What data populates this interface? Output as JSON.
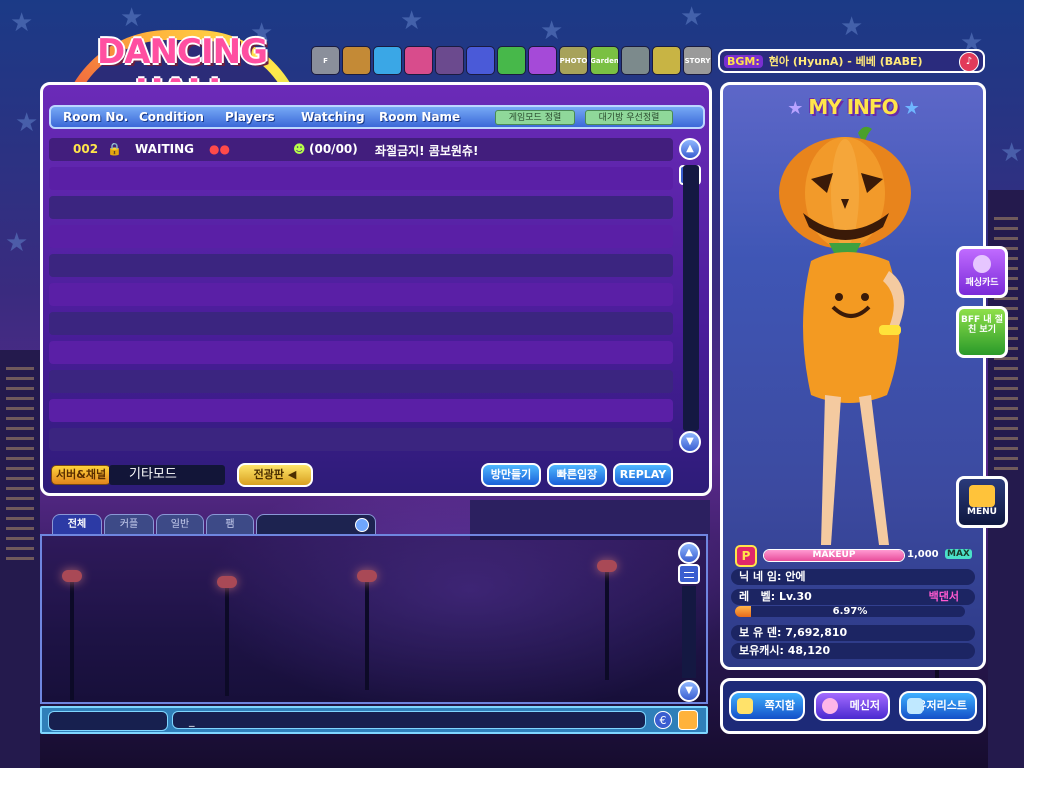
{
  "logo": {
    "text": "DANCING HALL"
  },
  "toolbar": [
    {
      "icon": "fashion-icon",
      "label": "F",
      "color": "#8a8f9b"
    },
    {
      "icon": "bag-icon",
      "label": "",
      "color": "#c48a36"
    },
    {
      "icon": "dance-icon",
      "label": "",
      "color": "#3aa7e6"
    },
    {
      "icon": "gift-icon",
      "label": "",
      "color": "#d84c8c"
    },
    {
      "icon": "music-icon",
      "label": "",
      "color": "#6b4a8e"
    },
    {
      "icon": "club-icon",
      "label": "",
      "color": "#4a5ad8"
    },
    {
      "icon": "leaf-icon",
      "label": "",
      "color": "#47b84a"
    },
    {
      "icon": "tv-icon",
      "label": "",
      "color": "#a54ad8"
    },
    {
      "icon": "photo-icon",
      "label": "PHOTO",
      "color": "#a7a25a"
    },
    {
      "icon": "garden-icon",
      "label": "Garden",
      "color": "#7ac043"
    },
    {
      "icon": "ear-icon",
      "label": "",
      "color": "#7c8a8c"
    },
    {
      "icon": "book-icon",
      "label": "",
      "color": "#c8b444"
    },
    {
      "icon": "story-icon",
      "label": "STORY",
      "color": "#9a9a9a"
    }
  ],
  "bgm": {
    "tag": "BGM:",
    "song": "현아 (HyunA) - 베베 (BABE)"
  },
  "room_list": {
    "columns": [
      "Room No.",
      "Condition",
      "Players",
      "Watching",
      "Room Name"
    ],
    "header_buttons": [
      "게임모드 정렬",
      "대기방 우선정렬"
    ],
    "rooms": [
      {
        "no": "002",
        "condition": "WAITING",
        "watching": "(00/00)",
        "name": "좌절금지! 콤보원츄!"
      }
    ],
    "empty_rows": 10
  },
  "server": {
    "label": "서버&채널",
    "value": "기타모드"
  },
  "buttons": {
    "broadcast": "전광판",
    "make_room": "방만들기",
    "quick_join": "빠른입장",
    "replay": "REPLAY"
  },
  "chat": {
    "tabs": [
      "전체",
      "커플",
      "일반",
      "팸"
    ],
    "input_value": "_"
  },
  "my_info": {
    "title": "MY INFO",
    "makeup_label": "MAKEUP",
    "makeup_value": "1,000",
    "max_badge": "MAX",
    "makeup_fraction": 1.0,
    "nickname_label": "닉 네 임:",
    "nickname": "안에",
    "level_label": "레   벨:",
    "level": "Lv.30",
    "title_badge": "백댄서",
    "exp_percent_text": "6.97%",
    "exp_fraction": 0.0697,
    "den_label": "보 유 덴:",
    "den": "7,692,810",
    "cash_label": "보유캐시:",
    "cash": "48,120"
  },
  "side_buttons": [
    "패싱카드",
    "BFF 내 절친 보기",
    "MENU"
  ],
  "bottom_menu": [
    "쪽지함",
    "메신저",
    "유저리스트"
  ],
  "colors": {
    "panel_purple": "#5a1fa6",
    "accent_yellow": "#ffe54a",
    "header_blue": "#3b68d8"
  }
}
